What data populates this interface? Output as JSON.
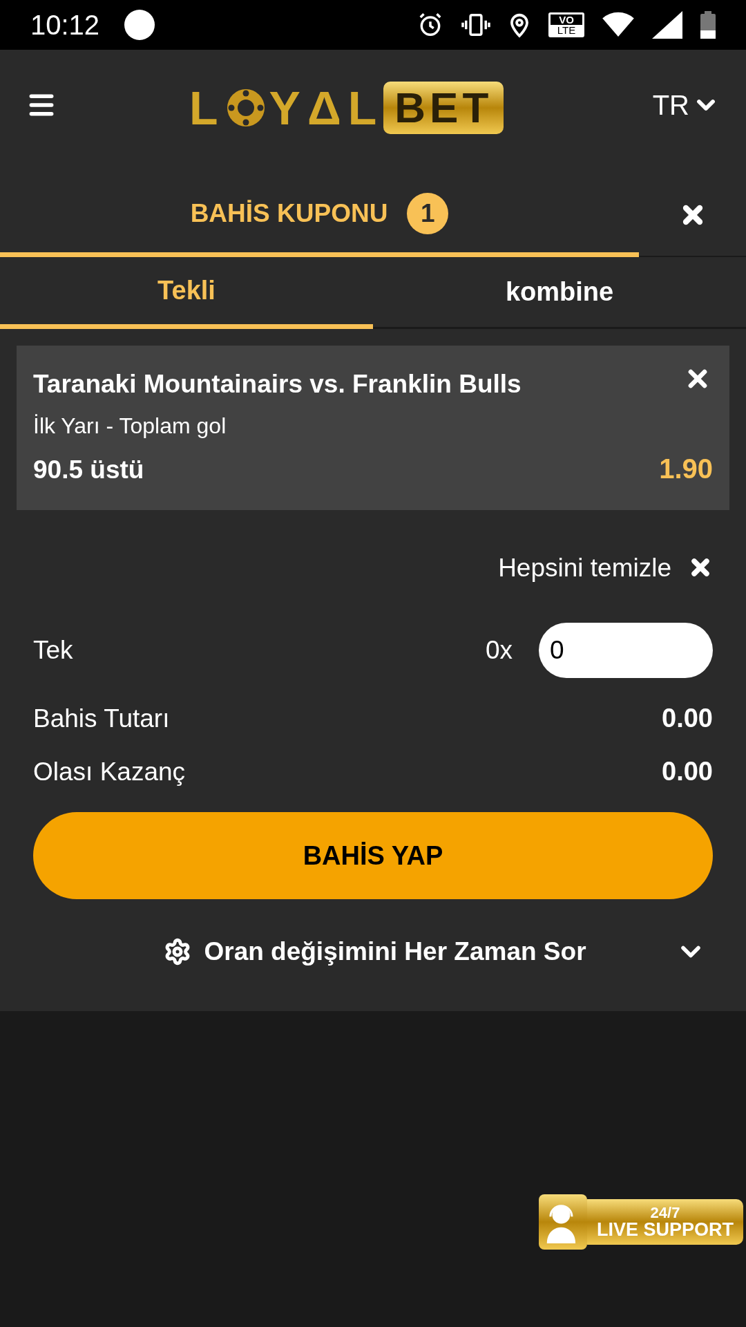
{
  "status_bar": {
    "time": "10:12",
    "volte": [
      "VO",
      "LTE"
    ]
  },
  "header": {
    "logo": {
      "first": "L",
      "middle": "YΔL",
      "badge": "BET"
    },
    "language": "TR"
  },
  "coupon": {
    "title": "BAHİS KUPONU",
    "count": "1"
  },
  "tabs": [
    {
      "label": "Tekli",
      "selected": true
    },
    {
      "label": "kombine",
      "selected": false
    }
  ],
  "bets": [
    {
      "match": "Taranaki Mountainairs vs. Franklin Bulls",
      "market": "İlk Yarı - Toplam gol",
      "selection": "90.5 üstü",
      "odds": "1.90"
    }
  ],
  "clear_all": "Hepsini temizle",
  "stake": {
    "label": "Tek",
    "multiplier": "0x",
    "value": "0"
  },
  "summary": [
    {
      "label": "Bahis Tutarı",
      "value": "0.00"
    },
    {
      "label": "Olası Kazanç",
      "value": "0.00"
    }
  ],
  "place_bet": "BAHİS YAP",
  "odds_change": "Oran değişimini Her Zaman Sor",
  "live_support": {
    "top": "24/7",
    "bottom": "LIVE SUPPORT"
  }
}
